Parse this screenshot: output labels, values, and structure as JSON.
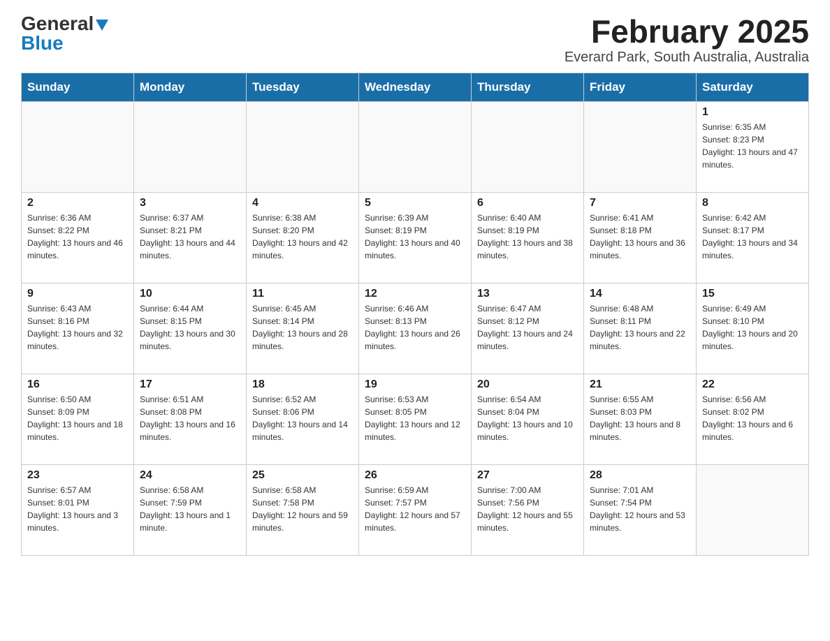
{
  "logo": {
    "text_general": "General",
    "text_blue": "Blue"
  },
  "header": {
    "month_year": "February 2025",
    "location": "Everard Park, South Australia, Australia"
  },
  "weekdays": [
    "Sunday",
    "Monday",
    "Tuesday",
    "Wednesday",
    "Thursday",
    "Friday",
    "Saturday"
  ],
  "weeks": [
    [
      {
        "day": "",
        "info": ""
      },
      {
        "day": "",
        "info": ""
      },
      {
        "day": "",
        "info": ""
      },
      {
        "day": "",
        "info": ""
      },
      {
        "day": "",
        "info": ""
      },
      {
        "day": "",
        "info": ""
      },
      {
        "day": "1",
        "info": "Sunrise: 6:35 AM\nSunset: 8:23 PM\nDaylight: 13 hours and 47 minutes."
      }
    ],
    [
      {
        "day": "2",
        "info": "Sunrise: 6:36 AM\nSunset: 8:22 PM\nDaylight: 13 hours and 46 minutes."
      },
      {
        "day": "3",
        "info": "Sunrise: 6:37 AM\nSunset: 8:21 PM\nDaylight: 13 hours and 44 minutes."
      },
      {
        "day": "4",
        "info": "Sunrise: 6:38 AM\nSunset: 8:20 PM\nDaylight: 13 hours and 42 minutes."
      },
      {
        "day": "5",
        "info": "Sunrise: 6:39 AM\nSunset: 8:19 PM\nDaylight: 13 hours and 40 minutes."
      },
      {
        "day": "6",
        "info": "Sunrise: 6:40 AM\nSunset: 8:19 PM\nDaylight: 13 hours and 38 minutes."
      },
      {
        "day": "7",
        "info": "Sunrise: 6:41 AM\nSunset: 8:18 PM\nDaylight: 13 hours and 36 minutes."
      },
      {
        "day": "8",
        "info": "Sunrise: 6:42 AM\nSunset: 8:17 PM\nDaylight: 13 hours and 34 minutes."
      }
    ],
    [
      {
        "day": "9",
        "info": "Sunrise: 6:43 AM\nSunset: 8:16 PM\nDaylight: 13 hours and 32 minutes."
      },
      {
        "day": "10",
        "info": "Sunrise: 6:44 AM\nSunset: 8:15 PM\nDaylight: 13 hours and 30 minutes."
      },
      {
        "day": "11",
        "info": "Sunrise: 6:45 AM\nSunset: 8:14 PM\nDaylight: 13 hours and 28 minutes."
      },
      {
        "day": "12",
        "info": "Sunrise: 6:46 AM\nSunset: 8:13 PM\nDaylight: 13 hours and 26 minutes."
      },
      {
        "day": "13",
        "info": "Sunrise: 6:47 AM\nSunset: 8:12 PM\nDaylight: 13 hours and 24 minutes."
      },
      {
        "day": "14",
        "info": "Sunrise: 6:48 AM\nSunset: 8:11 PM\nDaylight: 13 hours and 22 minutes."
      },
      {
        "day": "15",
        "info": "Sunrise: 6:49 AM\nSunset: 8:10 PM\nDaylight: 13 hours and 20 minutes."
      }
    ],
    [
      {
        "day": "16",
        "info": "Sunrise: 6:50 AM\nSunset: 8:09 PM\nDaylight: 13 hours and 18 minutes."
      },
      {
        "day": "17",
        "info": "Sunrise: 6:51 AM\nSunset: 8:08 PM\nDaylight: 13 hours and 16 minutes."
      },
      {
        "day": "18",
        "info": "Sunrise: 6:52 AM\nSunset: 8:06 PM\nDaylight: 13 hours and 14 minutes."
      },
      {
        "day": "19",
        "info": "Sunrise: 6:53 AM\nSunset: 8:05 PM\nDaylight: 13 hours and 12 minutes."
      },
      {
        "day": "20",
        "info": "Sunrise: 6:54 AM\nSunset: 8:04 PM\nDaylight: 13 hours and 10 minutes."
      },
      {
        "day": "21",
        "info": "Sunrise: 6:55 AM\nSunset: 8:03 PM\nDaylight: 13 hours and 8 minutes."
      },
      {
        "day": "22",
        "info": "Sunrise: 6:56 AM\nSunset: 8:02 PM\nDaylight: 13 hours and 6 minutes."
      }
    ],
    [
      {
        "day": "23",
        "info": "Sunrise: 6:57 AM\nSunset: 8:01 PM\nDaylight: 13 hours and 3 minutes."
      },
      {
        "day": "24",
        "info": "Sunrise: 6:58 AM\nSunset: 7:59 PM\nDaylight: 13 hours and 1 minute."
      },
      {
        "day": "25",
        "info": "Sunrise: 6:58 AM\nSunset: 7:58 PM\nDaylight: 12 hours and 59 minutes."
      },
      {
        "day": "26",
        "info": "Sunrise: 6:59 AM\nSunset: 7:57 PM\nDaylight: 12 hours and 57 minutes."
      },
      {
        "day": "27",
        "info": "Sunrise: 7:00 AM\nSunset: 7:56 PM\nDaylight: 12 hours and 55 minutes."
      },
      {
        "day": "28",
        "info": "Sunrise: 7:01 AM\nSunset: 7:54 PM\nDaylight: 12 hours and 53 minutes."
      },
      {
        "day": "",
        "info": ""
      }
    ]
  ]
}
